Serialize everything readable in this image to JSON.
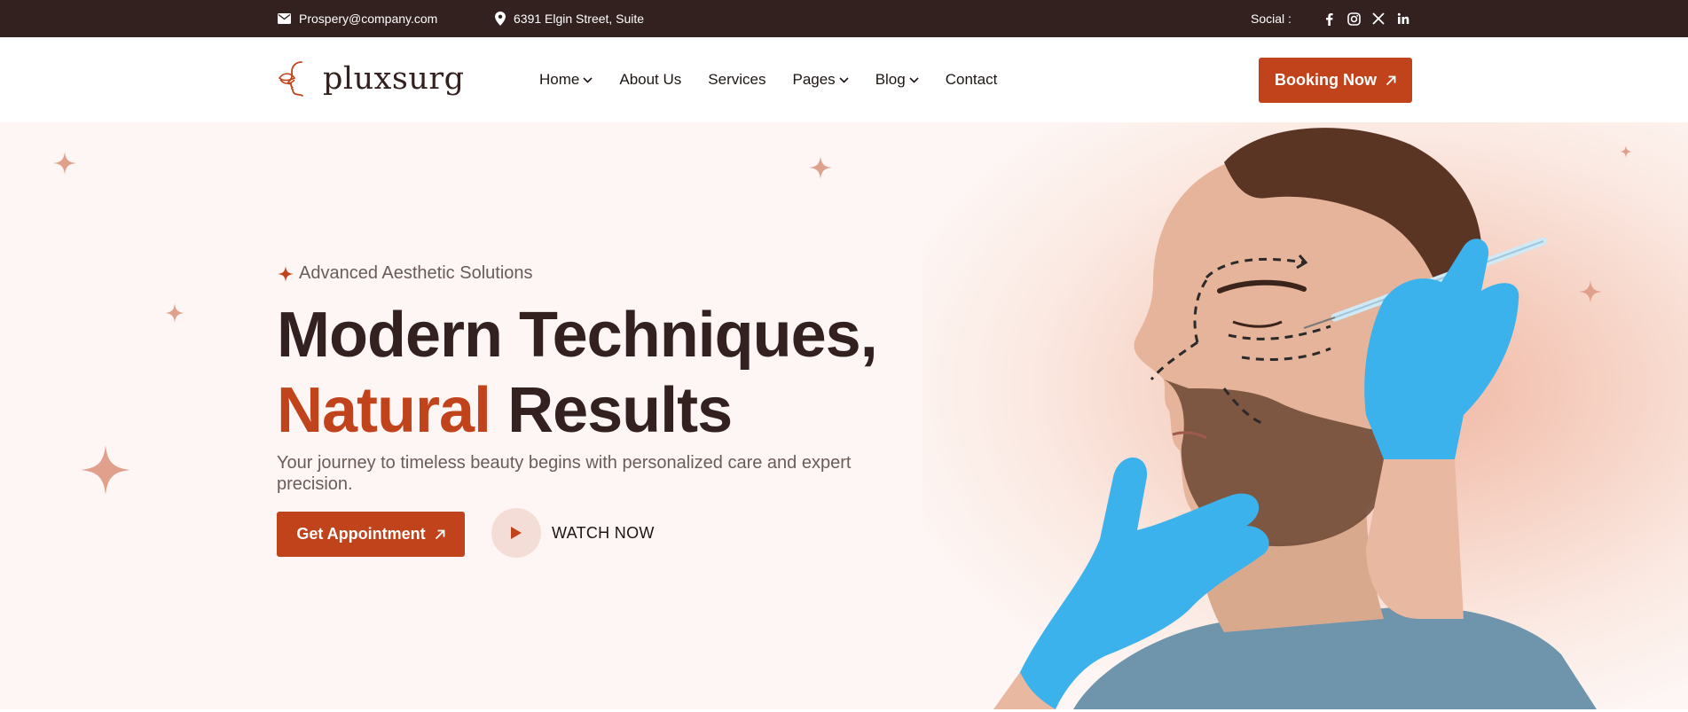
{
  "topbar": {
    "email": "Prospery@company.com",
    "address": "6391 Elgin Street, Suite",
    "social_label": "Social :",
    "social_icons": [
      "facebook-icon",
      "instagram-icon",
      "x-icon",
      "linkedin-icon"
    ]
  },
  "header": {
    "logo_text": "pluxsurg",
    "nav": [
      {
        "label": "Home",
        "has_dropdown": true
      },
      {
        "label": "About Us",
        "has_dropdown": false
      },
      {
        "label": "Services",
        "has_dropdown": false
      },
      {
        "label": "Pages",
        "has_dropdown": true
      },
      {
        "label": "Blog",
        "has_dropdown": true
      },
      {
        "label": "Contact",
        "has_dropdown": false
      }
    ],
    "booking_label": "Booking Now"
  },
  "hero": {
    "tagline": "Advanced Aesthetic Solutions",
    "headline_line1": "Modern Techniques,",
    "headline_accent": "Natural",
    "headline_rest": "Results",
    "subtext": "Your journey to timeless beauty begins with personalized care and expert precision.",
    "cta_label": "Get Appointment",
    "watch_label": "WATCH NOW"
  },
  "colors": {
    "brand": "#c1431b",
    "dark": "#32211f",
    "hero_bg": "#fdf6f4",
    "sparkle": "#e0a08c",
    "glove": "#3bb2ec"
  }
}
